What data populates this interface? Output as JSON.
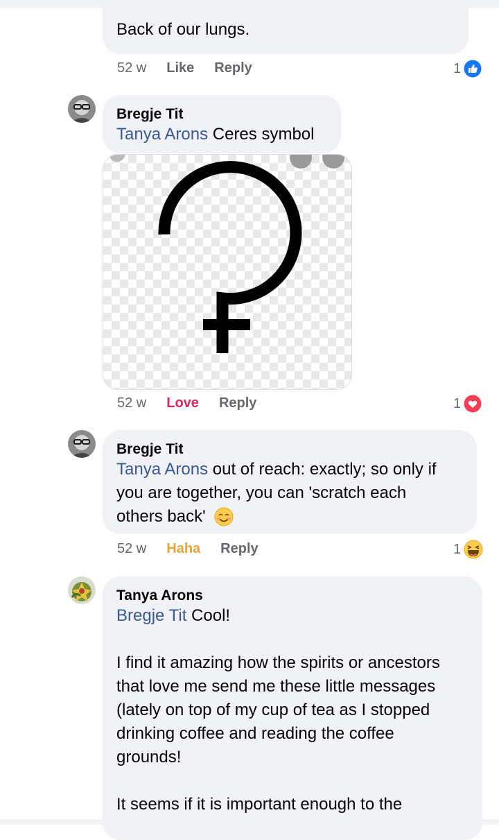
{
  "comments": [
    {
      "text": "Back of our lungs.",
      "age": "52 w",
      "action1": "Like",
      "action2": "Reply",
      "reaction_count": "1",
      "reaction_icon": "like-icon",
      "reaction_color": "#1877f2"
    },
    {
      "author": "Bregje Tit",
      "mention": "Tanya Arons",
      "text": " Ceres symbol",
      "age": "52 w",
      "action1": "Love",
      "action1_color": "#e0245e",
      "action2": "Reply",
      "reaction_count": "1",
      "reaction_icon": "love-icon",
      "image_icon": "ceres-symbol-icon"
    },
    {
      "author": "Bregje Tit",
      "mention": "Tanya Arons",
      "text_line1": " out of reach: exactly; so only if",
      "text_line2": "you are together, you can 'scratch each",
      "text_line3": "others back'",
      "emoji": "smiling-face-icon",
      "age": "52 w",
      "action1": "Haha",
      "action1_color": "#e8a33a",
      "action2": "Reply",
      "reaction_count": "1",
      "reaction_icon": "haha-icon"
    },
    {
      "author": "Tanya Arons",
      "mention": "Bregje Tit",
      "text": " Cool!",
      "para1_line1": "I find it amazing how the spirits or ancestors",
      "para1_line2": "that love me send me these little messages",
      "para1_line3": "(lately on top of my cup of tea as I stopped",
      "para1_line4": "drinking coffee and reading the coffee",
      "para1_line5": "grounds!",
      "para2_line1": "It seems if it is important enough to the"
    }
  ]
}
